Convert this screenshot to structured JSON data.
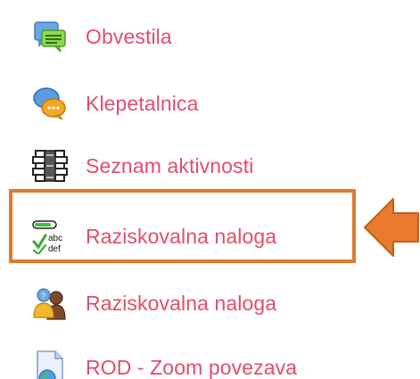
{
  "colors": {
    "link": "#e24d6a",
    "highlight": "#e07b2d"
  },
  "menu": {
    "items": [
      {
        "label": "Obvestila",
        "icon": "forum-icon"
      },
      {
        "label": "Klepetalnica",
        "icon": "chat-icon"
      },
      {
        "label": "Seznam aktivnosti",
        "icon": "checklist-icon"
      },
      {
        "label": "Raziskovalna naloga",
        "icon": "progress-check-icon",
        "highlighted": true
      },
      {
        "label": "Raziskovalna naloga",
        "icon": "group-icon"
      },
      {
        "label": "ROD - Zoom povezava",
        "icon": "url-icon"
      }
    ],
    "icon_text": {
      "abc": "abc",
      "def": "def"
    }
  }
}
